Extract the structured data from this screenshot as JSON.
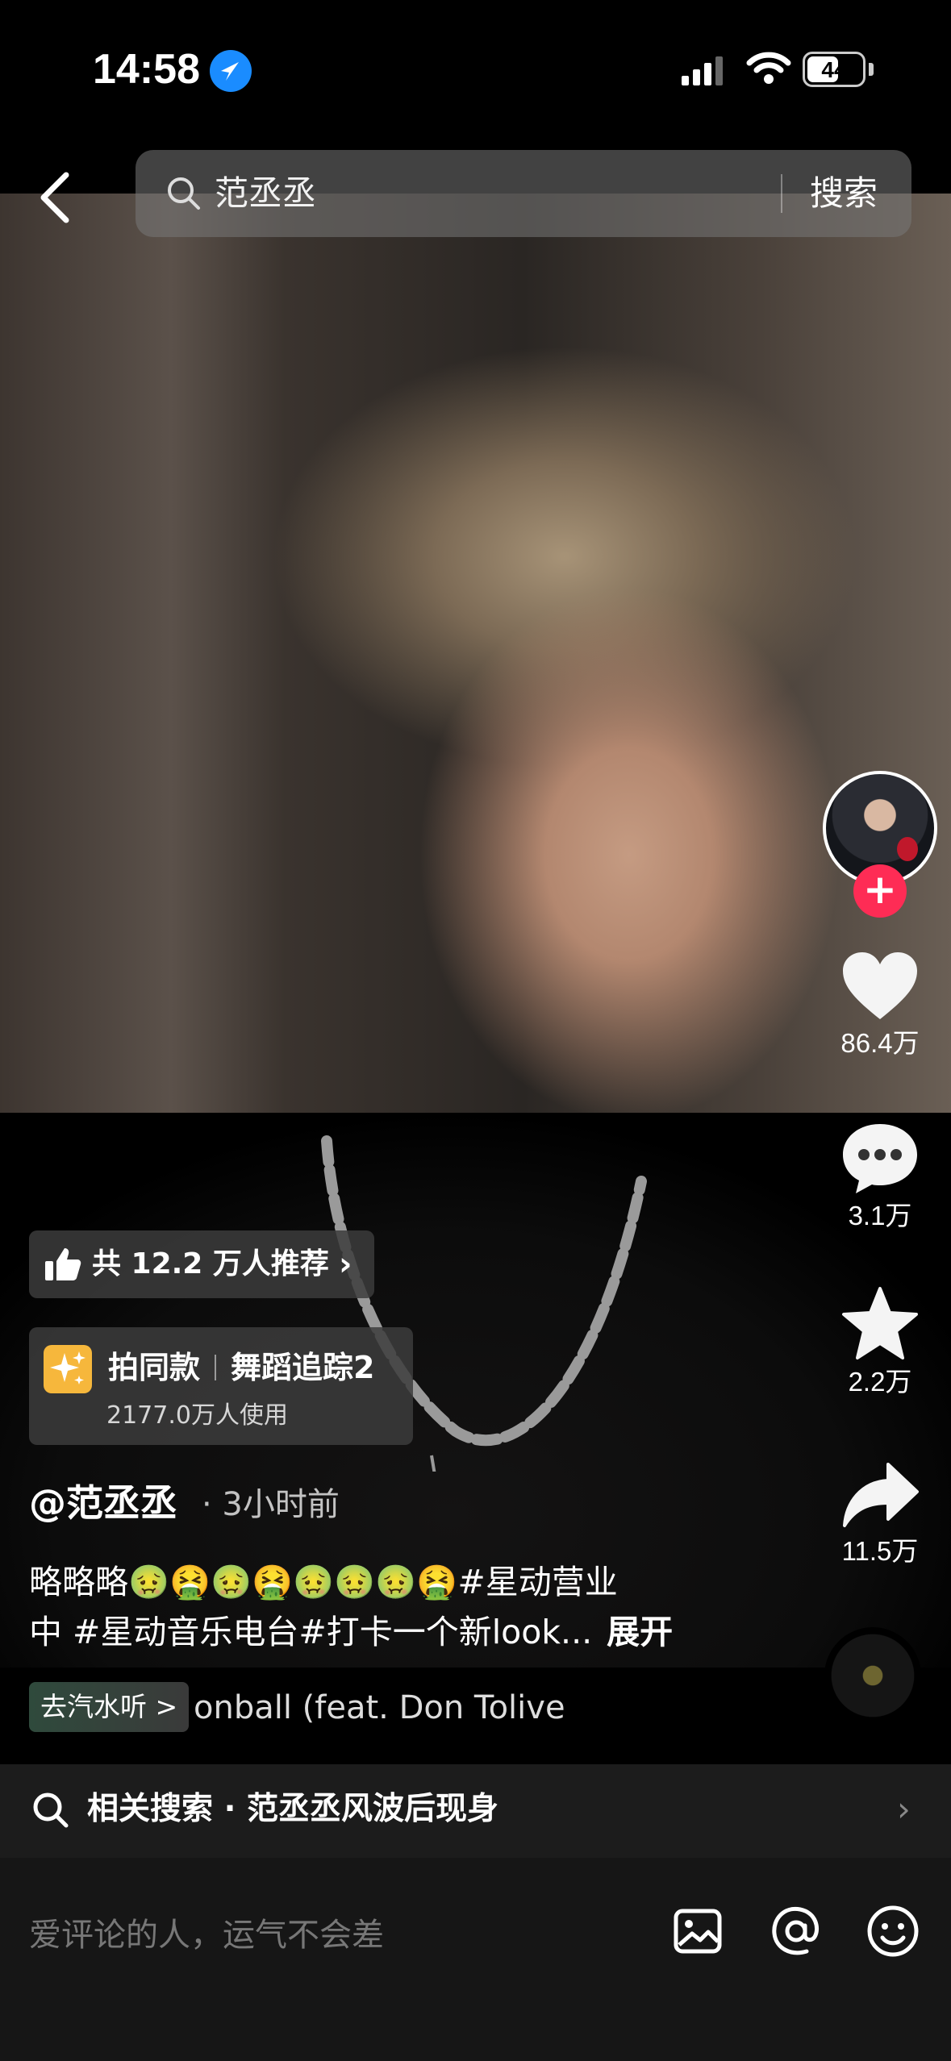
{
  "status_bar": {
    "time": "14:58",
    "battery": "44"
  },
  "search": {
    "query": "范丞丞",
    "submit_label": "搜索"
  },
  "actions": {
    "likes": "86.4万",
    "comments": "3.1万",
    "favorites": "2.2万",
    "shares": "11.5万",
    "follow_symbol": "+"
  },
  "recommend": {
    "text": "共 12.2 万人推荐"
  },
  "effect": {
    "title": "拍同款",
    "name": "舞蹈追踪2",
    "users": "2177.0万人使用"
  },
  "post": {
    "author": "@范丞丞",
    "time": "· 3小时前",
    "caption_line1": "略略略🤢🤮🤢🤮🤢🤢🤢🤮#星动营业",
    "caption_line2": "中 #星动音乐电台#打卡一个新look...",
    "expand_label": "展开"
  },
  "music": {
    "tag": "去汽水听 >",
    "title": "onball (feat. Don Tolive"
  },
  "related": {
    "label": "相关搜索 · 范丞丞风波后现身"
  },
  "comment": {
    "placeholder": "爱评论的人，运气不会差"
  },
  "icons": {
    "back": "chevron-left-icon",
    "search": "search-icon",
    "like": "heart-icon",
    "comment": "comment-bubble-icon",
    "favorite": "star-icon",
    "share": "share-arrow-icon",
    "image": "image-icon",
    "mention": "at-icon",
    "emoji": "emoji-icon"
  },
  "colors": {
    "follow": "#fe2c55",
    "location": "#1a8cff",
    "effect_icon": "#f6b73c"
  }
}
